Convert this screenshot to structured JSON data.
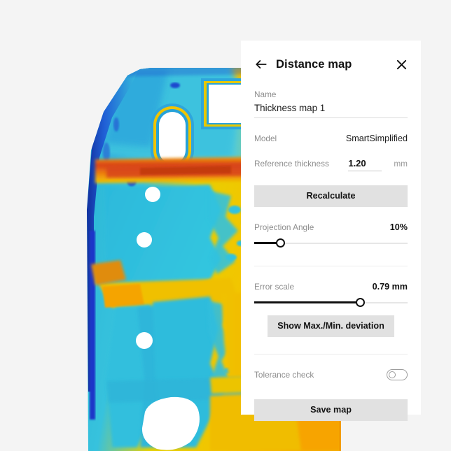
{
  "background_color": "#f4f4f4",
  "viewport": {
    "name": "thickness-map-3d-view",
    "description": "False-color thickness map of a molded part",
    "colors": {
      "thin": "#2bb8d8",
      "deep_blue": "#1b3fd8",
      "mid": "#f2d400",
      "thick": "#f5a800",
      "max": "#d84a12",
      "hole": "#ffffff"
    }
  },
  "panel": {
    "title": "Distance map",
    "back_icon": "arrow-left-icon",
    "close_icon": "close-icon",
    "name": {
      "label": "Name",
      "value": "Thickness map 1"
    },
    "model": {
      "label": "Model",
      "value": "SmartSimplified"
    },
    "reference_thickness": {
      "label": "Reference thickness",
      "value": "1.20",
      "unit": "mm"
    },
    "recalculate_button": "Recalculate",
    "projection_angle": {
      "label": "Projection Angle",
      "value": "10%",
      "percent": 17
    },
    "error_scale": {
      "label": "Error scale",
      "value": "0.79 mm",
      "percent": 69
    },
    "deviation_button": "Show Max./Min. deviation",
    "tolerance_check": {
      "label": "Tolerance check",
      "state": "off"
    },
    "save_button": "Save map"
  }
}
